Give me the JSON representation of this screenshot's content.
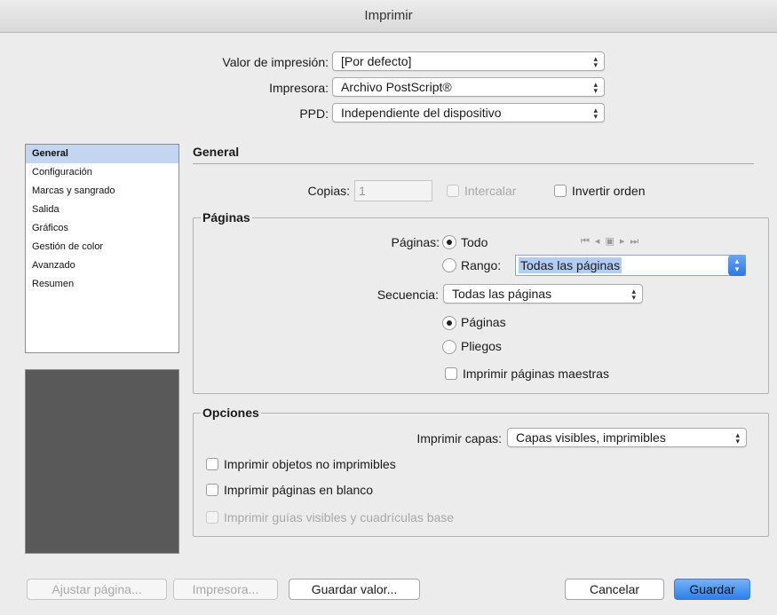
{
  "window": {
    "title": "Imprimir"
  },
  "top": {
    "preset_label": "Valor de impresión:",
    "preset_value": "[Por defecto]",
    "printer_label": "Impresora:",
    "printer_value": "Archivo PostScript®",
    "ppd_label": "PPD:",
    "ppd_value": "Independiente del dispositivo"
  },
  "sidebar": {
    "items": [
      {
        "label": "General"
      },
      {
        "label": "Configuración"
      },
      {
        "label": "Marcas y sangrado"
      },
      {
        "label": "Salida"
      },
      {
        "label": "Gráficos"
      },
      {
        "label": "Gestión de color"
      },
      {
        "label": "Avanzado"
      },
      {
        "label": "Resumen"
      }
    ],
    "selected_index": 0
  },
  "general": {
    "title": "General",
    "copies_label": "Copias:",
    "copies_value": "1",
    "collate_label": "Intercalar",
    "reverse_label": "Invertir orden"
  },
  "pages_group": {
    "title": "Páginas",
    "pages_label": "Páginas:",
    "all_label": "Todo",
    "range_label": "Rango:",
    "range_value": "Todas las páginas",
    "sequence_label": "Secuencia:",
    "sequence_value": "Todas las páginas",
    "pages_radio_label": "Páginas",
    "spreads_radio_label": "Pliegos",
    "master_pages_label": "Imprimir páginas maestras"
  },
  "options_group": {
    "title": "Opciones",
    "layers_label": "Imprimir capas:",
    "layers_value": "Capas visibles, imprimibles",
    "nonprinting_label": "Imprimir objetos no imprimibles",
    "blank_pages_label": "Imprimir páginas en blanco",
    "guides_label": "Imprimir guías visibles y cuadrículas base"
  },
  "buttons": {
    "page_setup": "Ajustar página...",
    "printer": "Impresora...",
    "save_preset": "Guardar valor...",
    "cancel": "Cancelar",
    "save": "Guardar"
  },
  "icons": {
    "nav": [
      "first-page-icon",
      "prev-page-icon",
      "page-icon",
      "next-page-icon",
      "last-page-icon"
    ]
  },
  "colors": {
    "accent": "#2c7fec",
    "selection": "#c3d5ef"
  }
}
